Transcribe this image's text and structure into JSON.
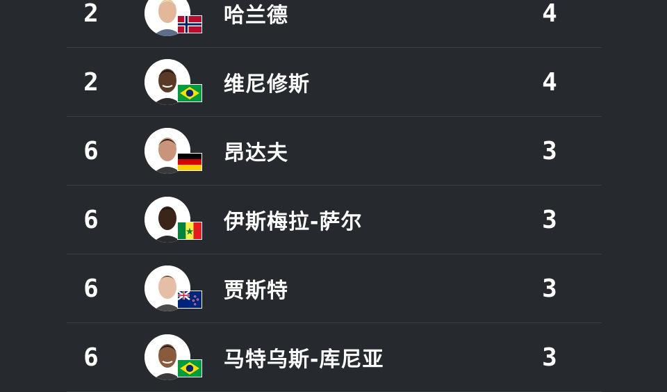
{
  "rows": [
    {
      "rank": "2",
      "name": "哈兰德",
      "goals": "4",
      "flag": "norway-flag"
    },
    {
      "rank": "2",
      "name": "维尼修斯",
      "goals": "4",
      "flag": "brazil-flag"
    },
    {
      "rank": "6",
      "name": "昂达夫",
      "goals": "3",
      "flag": "germany-flag"
    },
    {
      "rank": "6",
      "name": "伊斯梅拉-萨尔",
      "goals": "3",
      "flag": "senegal-flag"
    },
    {
      "rank": "6",
      "name": "贾斯特",
      "goals": "3",
      "flag": "new-zealand-flag"
    },
    {
      "rank": "6",
      "name": "马特乌斯-库尼亚",
      "goals": "3",
      "flag": "brazil-flag"
    }
  ]
}
